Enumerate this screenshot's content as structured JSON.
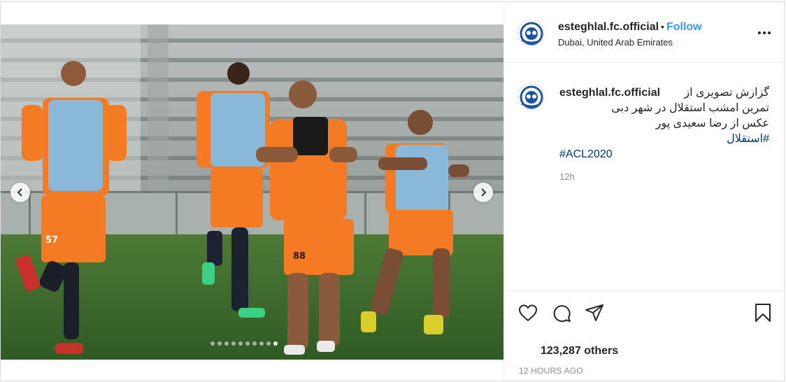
{
  "account": {
    "username": "esteghlal.fc.official",
    "separator": "•",
    "follow_label": "Follow",
    "location": "Dubai, United Arab Emirates"
  },
  "caption": {
    "username": "esteghlal.fc.official",
    "line1": "گزارش تصویری از",
    "line2": "تمرین امشب استقلال در شهر دبی",
    "line3": "عکس از رضا سعیدی پور",
    "hashtag1": "#استقلال",
    "hashtag2": "#ACL2020",
    "time": "12h"
  },
  "engagement": {
    "likes_text": "123,287 others",
    "posted_ago": "12 HOURS AGO"
  },
  "carousel": {
    "total_slides": 10,
    "active_index": 9
  },
  "photo": {
    "shirt_numbers": [
      "57",
      "88"
    ],
    "colors": {
      "kit_orange": "#f47a24",
      "bib_blue": "#8ab8d8",
      "pitch": "#3e6b2e"
    }
  },
  "icons": [
    "more-options-icon",
    "heart-icon",
    "comment-icon",
    "share-icon",
    "bookmark-icon",
    "chevron-left-icon",
    "chevron-right-icon"
  ]
}
